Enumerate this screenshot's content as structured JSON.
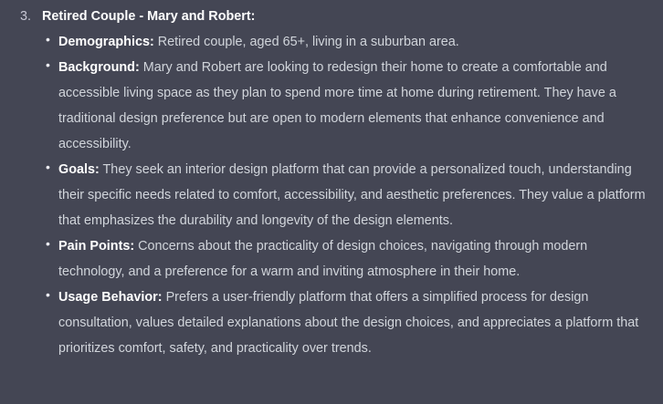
{
  "item": {
    "number": "3.",
    "title": "Retired Couple - Mary and Robert:"
  },
  "bullets": [
    {
      "label": "Demographics:",
      "text": " Retired couple, aged 65+, living in a suburban area."
    },
    {
      "label": "Background:",
      "text": " Mary and Robert are looking to redesign their home to create a comfortable and accessible living space as they plan to spend more time at home during retirement. They have a traditional design preference but are open to modern elements that enhance convenience and accessibility."
    },
    {
      "label": "Goals:",
      "text": " They seek an interior design platform that can provide a personalized touch, understanding their specific needs related to comfort, accessibility, and aesthetic preferences. They value a platform that emphasizes the durability and longevity of the design elements."
    },
    {
      "label": "Pain Points:",
      "text": " Concerns about the practicality of design choices, navigating through modern technology, and a preference for a warm and inviting atmosphere in their home."
    },
    {
      "label": "Usage Behavior:",
      "text": " Prefers a user-friendly platform that offers a simplified process for design consultation, values detailed explanations about the design choices, and appreciates a platform that prioritizes comfort, safety, and practicality over trends."
    }
  ]
}
